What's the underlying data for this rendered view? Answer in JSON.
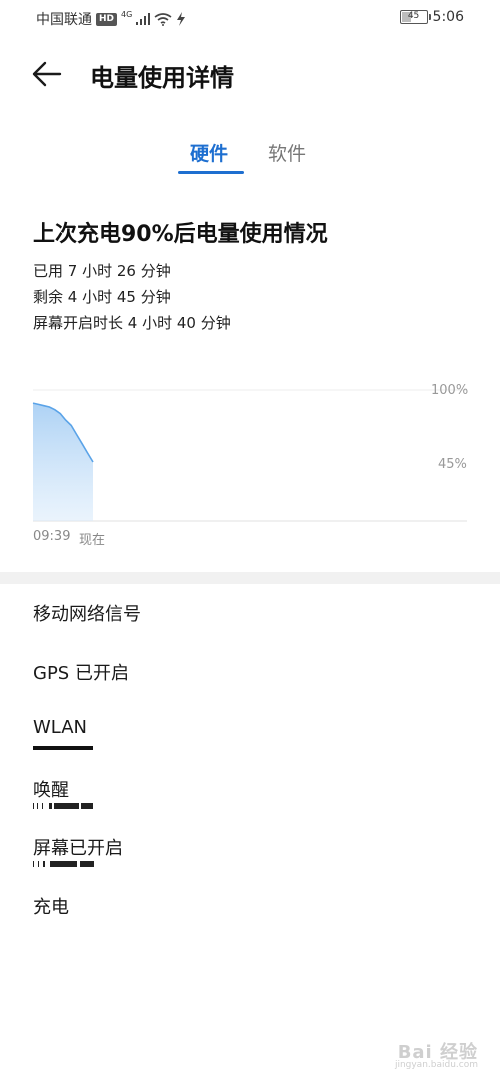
{
  "status_bar": {
    "carrier": "中国联通",
    "hd_badge": "HD",
    "network": "4G",
    "battery_level": "45",
    "battery_fraction": 0.45,
    "time": "5:06"
  },
  "header": {
    "title": "电量使用详情",
    "back_icon": "arrow-left-icon"
  },
  "tabs": [
    {
      "label": "硬件",
      "active": true
    },
    {
      "label": "软件",
      "active": false
    }
  ],
  "summary": {
    "title": "上次充电90%后电量使用情况",
    "used": "已用 7 小时 26 分钟",
    "remaining": "剩余 4 小时 45 分钟",
    "screen_on": "屏幕开启时长 4 小时 40 分钟"
  },
  "chart_data": {
    "type": "area",
    "y_ticks": [
      "100%",
      "45%"
    ],
    "x_labels": [
      "09:39",
      "现在"
    ],
    "ylim": [
      0,
      100
    ],
    "y": [
      90,
      89,
      88,
      87,
      85,
      82,
      77,
      73,
      66,
      59,
      52,
      45
    ],
    "grid": true,
    "color": "#5aa3e8"
  },
  "list": {
    "mobile_signal": "移动网络信号",
    "gps": "GPS 已开启",
    "wlan": "WLAN",
    "wake": "唤醒",
    "screen_on": "屏幕已开启",
    "charging": "充电"
  },
  "watermark": {
    "text": "Bai 经验",
    "sub": "jingyan.baidu.com"
  },
  "colors": {
    "accent": "#1e6fd0",
    "chart_line": "#5aa3e8",
    "band": "#f1f1f1"
  }
}
